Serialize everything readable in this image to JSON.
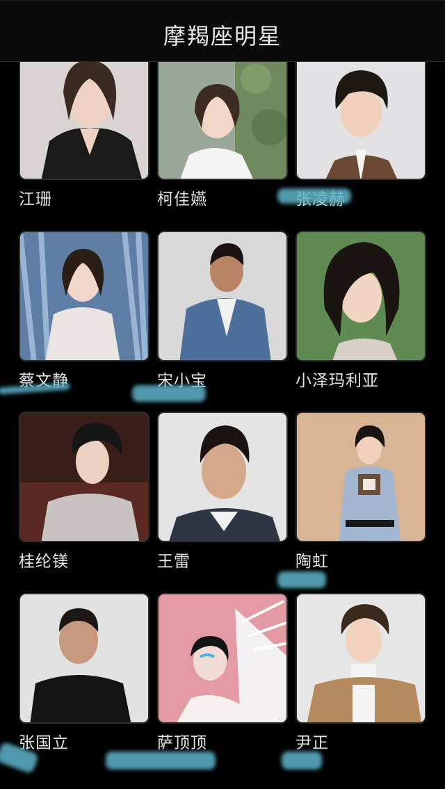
{
  "header": {
    "title": "摩羯座明星"
  },
  "celebrities": [
    {
      "name": "江珊"
    },
    {
      "name": "柯佳嬿"
    },
    {
      "name": "张凌赫"
    },
    {
      "name": "蔡文静"
    },
    {
      "name": "宋小宝"
    },
    {
      "name": "小泽玛利亚"
    },
    {
      "name": "桂纶镁"
    },
    {
      "name": "王雷"
    },
    {
      "name": "陶虹"
    },
    {
      "name": "张国立"
    },
    {
      "name": "萨顶顶"
    },
    {
      "name": "尹正"
    }
  ],
  "colors": {
    "background": "#000000",
    "text": "#e6e6e6",
    "scribble": "#5fb3c9"
  }
}
